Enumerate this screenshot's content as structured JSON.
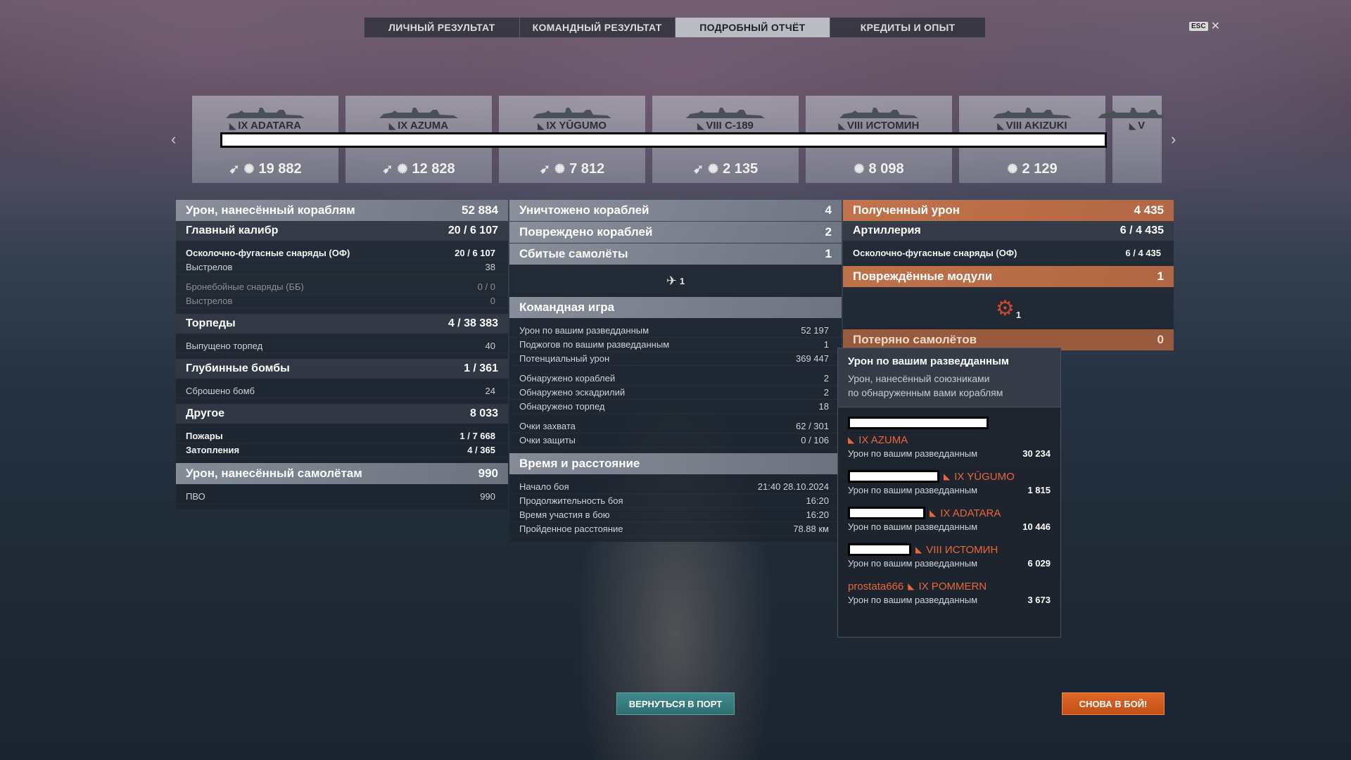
{
  "tabs": [
    "ЛИЧНЫЙ РЕЗУЛЬТАТ",
    "КОМАНДНЫЙ РЕЗУЛЬТАТ",
    "ПОДРОБНЫЙ ОТЧЁТ",
    "КРЕДИТЫ И ОПЫТ"
  ],
  "active_tab": "ПОДРОБНЫЙ ОТЧЁТ",
  "esc": {
    "key": "ESC",
    "close": "✕"
  },
  "arrows": {
    "left": "‹",
    "right": "›"
  },
  "ships": [
    {
      "name": "IX ADATARA",
      "damage": "19 882",
      "has_torpedo_icon": true
    },
    {
      "name": "IX AZUMA",
      "damage": "12 828",
      "has_torpedo_icon": true
    },
    {
      "name": "IX YŪGUMO",
      "damage": "7 812",
      "has_torpedo_icon": true
    },
    {
      "name": "VIII C-189",
      "damage": "2 135",
      "has_torpedo_icon": true
    },
    {
      "name": "VIII ИСТОМИН",
      "damage": "8 098",
      "has_torpedo_icon": false
    },
    {
      "name": "VIII AKIZUKI",
      "damage": "2 129",
      "has_torpedo_icon": false
    },
    {
      "name": "V",
      "damage": "",
      "has_torpedo_icon": false
    }
  ],
  "left": {
    "ship_damage": {
      "label": "Урон, нанесённый кораблям",
      "value": "52 884"
    },
    "main_battery": {
      "label": "Главный калибр",
      "hits": "20 / ",
      "value": "6 107"
    },
    "he": {
      "label": "Осколочно-фугасные снаряды (ОФ)",
      "hits": "20 / ",
      "value": "6 107"
    },
    "he_shots": {
      "label": "Выстрелов",
      "value": "38"
    },
    "ap": {
      "label": "Бронебойные снаряды (ББ)",
      "value": "0 / 0"
    },
    "ap_shots": {
      "label": "Выстрелов",
      "value": "0"
    },
    "torpedoes": {
      "label": "Торпеды",
      "hits": "4 / ",
      "value": "38 383"
    },
    "torp_launched": {
      "label": "Выпущено торпед",
      "value": "40"
    },
    "depth": {
      "label": "Глубинные бомбы",
      "value": "1 / 361"
    },
    "bombs_dropped": {
      "label": "Сброшено бомб",
      "value": "24"
    },
    "other": {
      "label": "Другое",
      "value": "8 033"
    },
    "fires": {
      "label": "Пожары",
      "hits": "1 / ",
      "value": "7 668"
    },
    "floods": {
      "label": "Затопления",
      "hits": "4 / ",
      "value": "365"
    },
    "plane_damage": {
      "label": "Урон, нанесённый самолётам",
      "value": "990"
    },
    "aa": {
      "label": "ПВО",
      "value": "990"
    }
  },
  "middle": {
    "destroyed": {
      "label": "Уничтожено кораблей",
      "value": "4"
    },
    "damaged": {
      "label": "Повреждено кораблей",
      "value": "2"
    },
    "planes_shot": {
      "label": "Сбитые самолёты",
      "value": "1"
    },
    "planes_icon_count": "1",
    "team_play": "Командная игра",
    "team_rows": [
      {
        "label": "Урон по вашим разведданным",
        "value": "52 197"
      },
      {
        "label": "Поджогов по вашим разведданным",
        "value": "1"
      },
      {
        "label": "Потенциальный урон",
        "value": "369 447"
      },
      {
        "label": "Обнаружено кораблей",
        "value": "2"
      },
      {
        "label": "Обнаружено эскадрилий",
        "value": "2"
      },
      {
        "label": "Обнаружено торпед",
        "value": "18"
      },
      {
        "label": "Очки захвата",
        "value": "62 / 301"
      },
      {
        "label": "Очки защиты",
        "value": "0 / 106"
      }
    ],
    "time_distance": "Время и расстояние",
    "time_rows": [
      {
        "label": "Начало боя",
        "value": "21:40  28.10.2024"
      },
      {
        "label": "Продолжительность боя",
        "value": "16:20"
      },
      {
        "label": "Время участия в бою",
        "value": "16:20"
      },
      {
        "label": "Пройденное расстояние",
        "value": "78.88 км"
      }
    ]
  },
  "right": {
    "received": {
      "label": "Полученный урон",
      "value": "4 435"
    },
    "artillery": {
      "label": "Артиллерия",
      "hits": "6 / ",
      "value": "4 435"
    },
    "he": {
      "label": "Осколочно-фугасные снаряды (ОФ)",
      "hits": "6 / ",
      "value": "4 435"
    },
    "modules": {
      "label": "Повреждённые модули",
      "value": "1"
    },
    "modules_icon_count": "1",
    "planes_lost": {
      "label": "Потеряно самолётов",
      "value": "0"
    }
  },
  "tooltip": {
    "title": "Урон по вашим разведданным",
    "subtitle1": "Урон, нанесённый союзниками",
    "subtitle2": "по обнаруженным вами кораблям",
    "entries": [
      {
        "player": "",
        "ship": "IX AZUMA",
        "label": "Урон по вашим разведданным",
        "value": "30 234"
      },
      {
        "player": "",
        "ship": "IX YŪGUMO",
        "label": "Урон по вашим разведданным",
        "value": "1 815"
      },
      {
        "player": "",
        "ship": "IX ADATARA",
        "label": "Урон по вашим разведданным",
        "value": "10 446"
      },
      {
        "player": "",
        "ship": "VIII ИСТОМИН",
        "label": "Урон по вашим разведданным",
        "value": "6 029"
      },
      {
        "player": "prostata666",
        "ship": "IX POMMERN",
        "label": "Урон по вашим разведданным",
        "value": "3 673"
      }
    ]
  },
  "buttons": {
    "port": "ВЕРНУТЬСЯ В ПОРТ",
    "battle": "СНОВА В БОЙ!"
  },
  "colors": {
    "accent_orange": "#e8673a",
    "teal_button": "#2f6f72",
    "battle_button": "#c24f17"
  }
}
